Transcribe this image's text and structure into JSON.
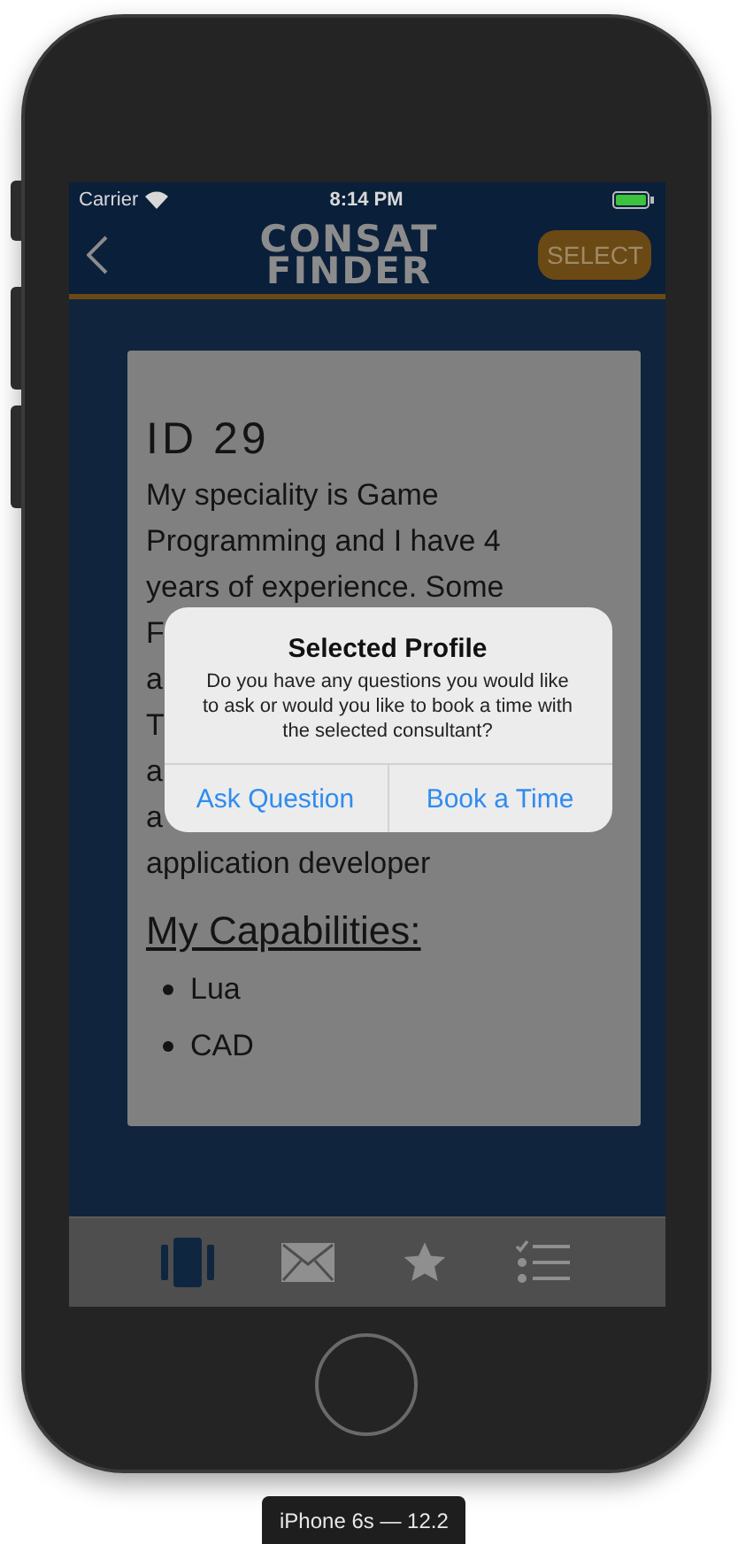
{
  "status_bar": {
    "carrier": "Carrier",
    "time": "8:14 PM"
  },
  "nav_bar": {
    "logo_lines": [
      "CONSAT",
      "FINDER"
    ],
    "action": "SELECT"
  },
  "profile": {
    "title": "ID 29",
    "description_lines": [
      "My speciality is Game",
      "Programming and I have 4",
      "years of experience. Some",
      "F",
      "a",
      "T",
      "a",
      "a",
      "application developer"
    ],
    "capabilities_heading": "My Capabilities:",
    "capabilities": [
      "Lua",
      "CAD"
    ]
  },
  "alert": {
    "title": "Selected Profile",
    "message": "Do you have any questions you would like to ask or would you like to book a time with the selected consultant?",
    "buttons": [
      "Ask Question",
      "Book a Time"
    ]
  },
  "tab_bar": [
    {
      "kind": "cards",
      "selected": true
    },
    {
      "kind": "mail",
      "selected": false
    },
    {
      "kind": "star",
      "selected": false
    },
    {
      "kind": "checklist",
      "selected": false
    }
  ],
  "device": {
    "label": "iPhone 6s — 12.2"
  }
}
